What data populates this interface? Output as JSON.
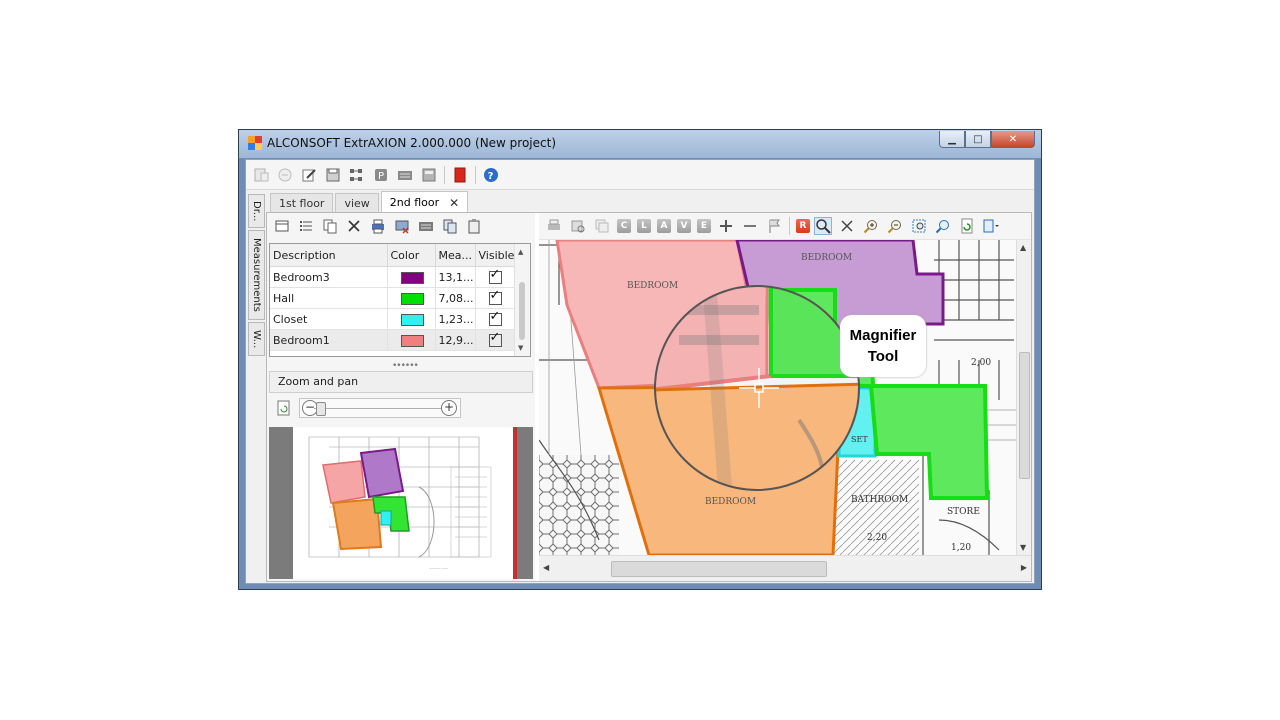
{
  "window": {
    "title": "ALCONSOFT ExtrAXION 2.000.000 (New project)"
  },
  "side_tabs": [
    "Dr...",
    "Measurements",
    "W..."
  ],
  "doc_tabs": [
    {
      "label": "1st floor"
    },
    {
      "label": "view"
    },
    {
      "label": "2nd floor",
      "active": true
    }
  ],
  "measurements": {
    "columns": [
      "Description",
      "Color",
      "Mea...",
      "Visible"
    ],
    "rows": [
      {
        "description": "Bedroom3",
        "color": "#800080",
        "measure": "13,1...",
        "visible": true
      },
      {
        "description": "Hall",
        "color": "#00e000",
        "measure": "7,08...",
        "visible": true
      },
      {
        "description": "Closet",
        "color": "#33f0f0",
        "measure": "1,23...",
        "visible": true
      },
      {
        "description": "Bedroom1",
        "color": "#f08080",
        "measure": "12,9...",
        "visible": true
      }
    ]
  },
  "zoom_pan": {
    "header": "Zoom and pan",
    "zoom_level": 0.05
  },
  "plan_labels": {
    "bedroom_top_left": "BEDROOM",
    "bedroom_top_right": "BEDROOM",
    "bedroom_bottom": "BEDROOM",
    "bathroom": "BATHROOM",
    "store": "STORE",
    "closet": "SET",
    "dim_220": "2,20",
    "dim_120": "1,20",
    "dim_200": "2,00"
  },
  "callout": {
    "line1": "Magnifier",
    "line2": "Tool"
  },
  "right_toolbar_letters": [
    "C",
    "L",
    "A",
    "V",
    "E"
  ],
  "colors": {
    "bedroom3": "#a96bc4",
    "hall": "#33e433",
    "closet": "#33f0f0",
    "bedroom1": "#f5a5a5",
    "bedroom_orange": "#f4a45c"
  }
}
